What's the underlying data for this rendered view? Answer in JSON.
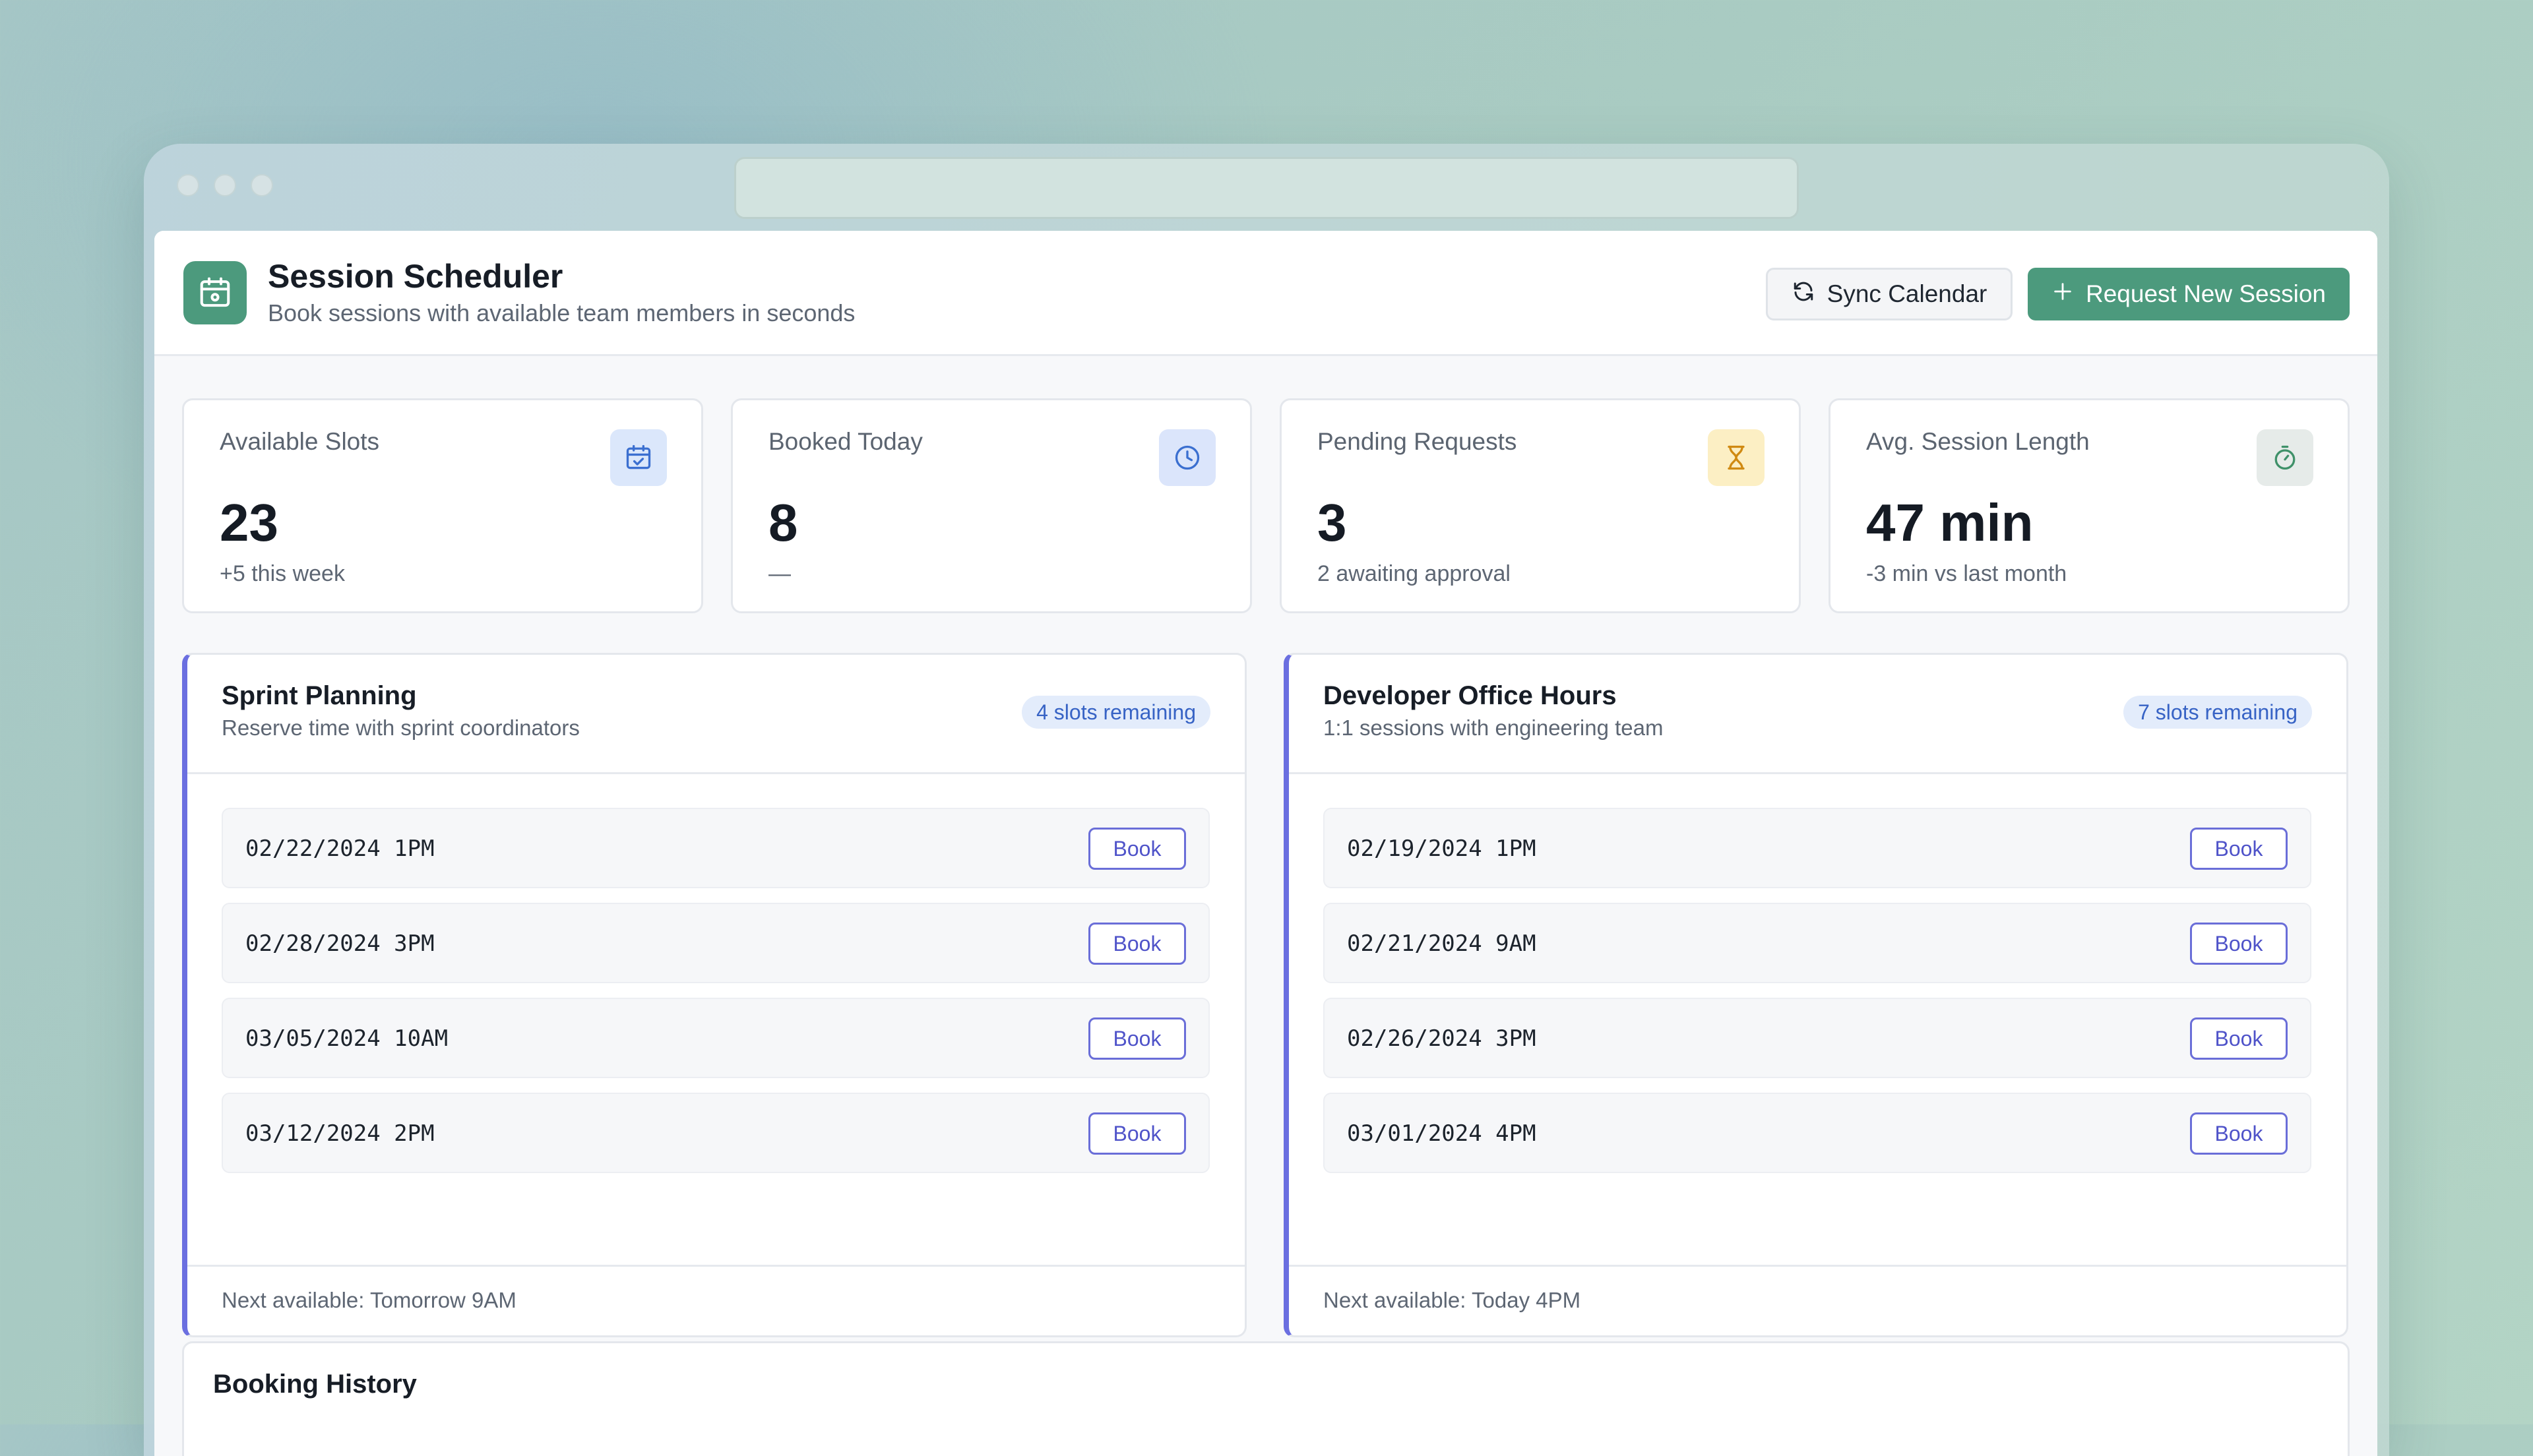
{
  "app": {
    "title": "Session Scheduler",
    "subtitle": "Book sessions with available team members in seconds",
    "sync_label": "Sync Calendar",
    "new_label": "Request New Session",
    "accent": "#4c9a7d"
  },
  "stats": [
    {
      "label": "Available Slots",
      "value": "23",
      "sub": "+5 this week",
      "icon": "calendar-check-icon"
    },
    {
      "label": "Booked Today",
      "value": "8",
      "sub": "—",
      "icon": "clock-icon"
    },
    {
      "label": "Pending Requests",
      "value": "3",
      "sub": "2 awaiting approval",
      "icon": "hourglass-icon"
    },
    {
      "label": "Avg. Session Length",
      "value": "47 min",
      "sub": "-3 min vs last month",
      "icon": "stopwatch-icon"
    }
  ],
  "sessions": [
    {
      "title": "Sprint Planning",
      "desc": "Reserve time with sprint coordinators",
      "badge": "4 slots remaining",
      "slots": [
        {
          "time": "02/22/2024 1PM",
          "action": "Book"
        },
        {
          "time": "02/28/2024 3PM",
          "action": "Book"
        },
        {
          "time": "03/05/2024 10AM",
          "action": "Book"
        },
        {
          "time": "03/12/2024 2PM",
          "action": "Book"
        }
      ],
      "footer": "Next available: Tomorrow 9AM"
    },
    {
      "title": "Developer Office Hours",
      "desc": "1:1 sessions with engineering team",
      "badge": "7 slots remaining",
      "slots": [
        {
          "time": "02/19/2024 1PM",
          "action": "Book"
        },
        {
          "time": "02/21/2024 9AM",
          "action": "Book"
        },
        {
          "time": "02/26/2024 3PM",
          "action": "Book"
        },
        {
          "time": "03/01/2024 4PM",
          "action": "Book"
        }
      ],
      "footer": "Next available: Today 4PM"
    }
  ],
  "history": {
    "title": "Booking History"
  }
}
